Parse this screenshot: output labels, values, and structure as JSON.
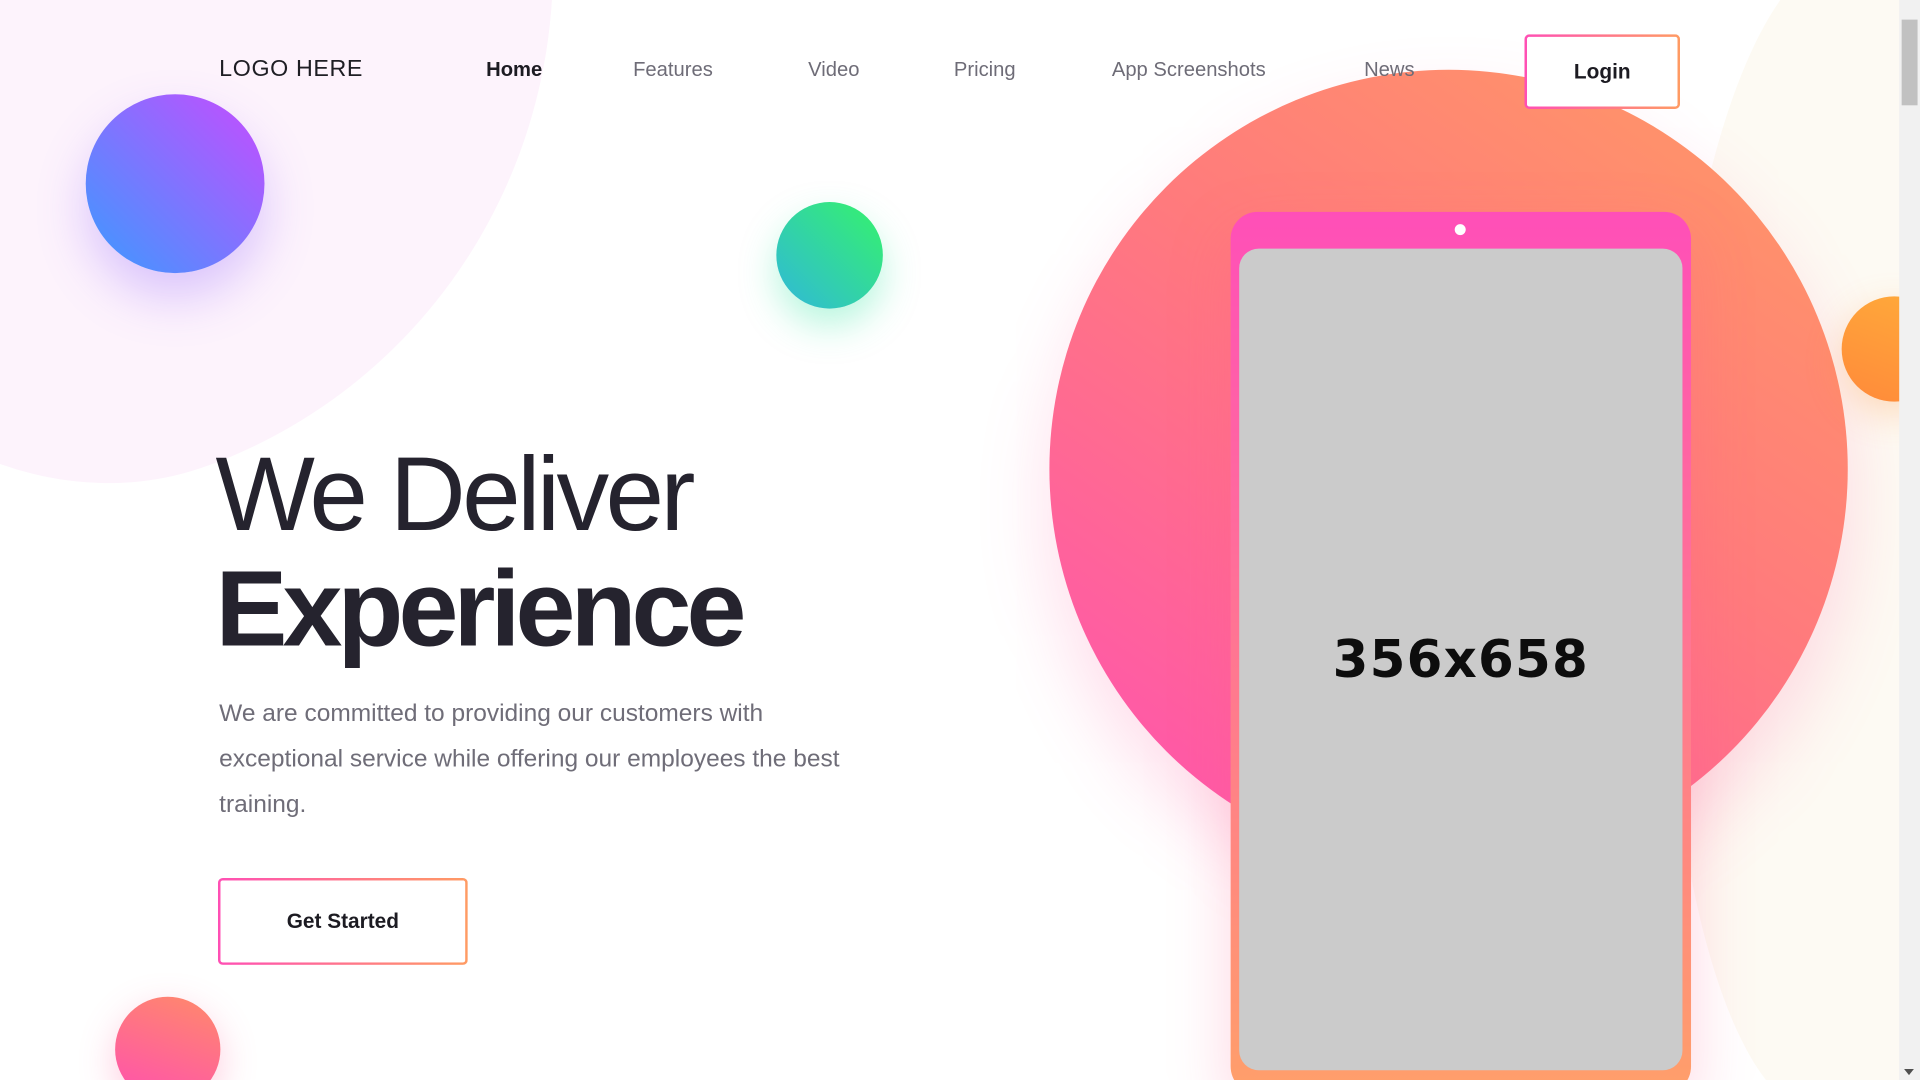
{
  "nav": {
    "logo": "LOGO HERE",
    "items": [
      {
        "label": "Home",
        "active": true
      },
      {
        "label": "Features",
        "active": false
      },
      {
        "label": "Video",
        "active": false
      },
      {
        "label": "Pricing",
        "active": false
      },
      {
        "label": "App Screenshots",
        "active": false
      },
      {
        "label": "News",
        "active": false
      }
    ],
    "login_label": "Login"
  },
  "hero": {
    "title_line1": "We Deliver",
    "title_line2": "Experience",
    "description": "We are committed to providing our customers with exceptional service while offering our employees the best training.",
    "cta_label": "Get Started"
  },
  "mockup": {
    "screen_placeholder": "356x658"
  },
  "colors": {
    "accent_pink": "#ff4fb4",
    "accent_orange": "#ff9b63",
    "text_dark": "#25232e",
    "text_muted": "#6f6d78"
  }
}
